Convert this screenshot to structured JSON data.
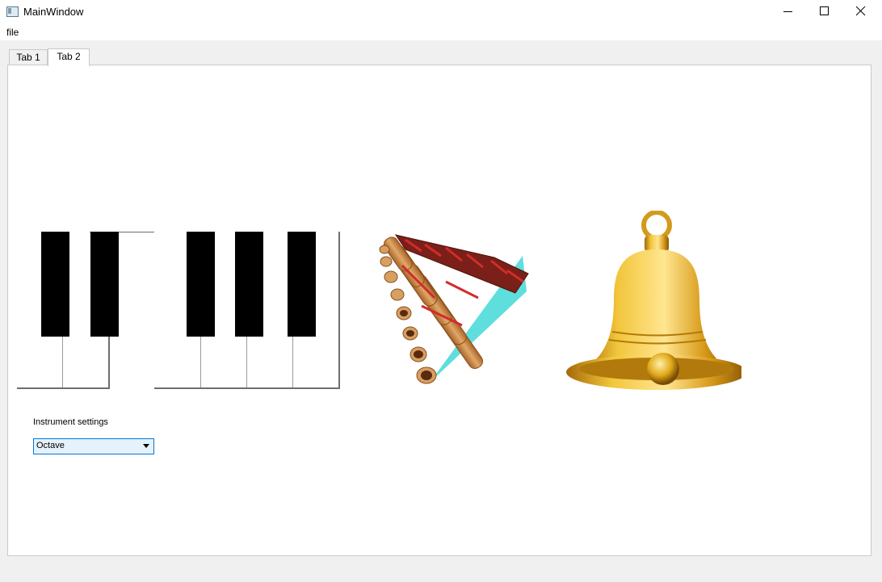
{
  "window": {
    "title": "MainWindow"
  },
  "menubar": {
    "file_label": "file"
  },
  "tabs": [
    {
      "label": "Tab 1",
      "active": false
    },
    {
      "label": "Tab 2",
      "active": true
    }
  ],
  "icons": {
    "piano": "piano-keyboard-icon",
    "panflute": "pan-flute-icon",
    "bell": "golden-bell-icon"
  },
  "settings": {
    "label": "Instrument settings",
    "combo_value": "Octave"
  },
  "colors": {
    "combo_border": "#0078d7",
    "combo_bg": "#e5f1fb",
    "bell_gold": "#e0a818",
    "flute_wood": "#c8843c",
    "flute_band": "#d42b2b"
  }
}
